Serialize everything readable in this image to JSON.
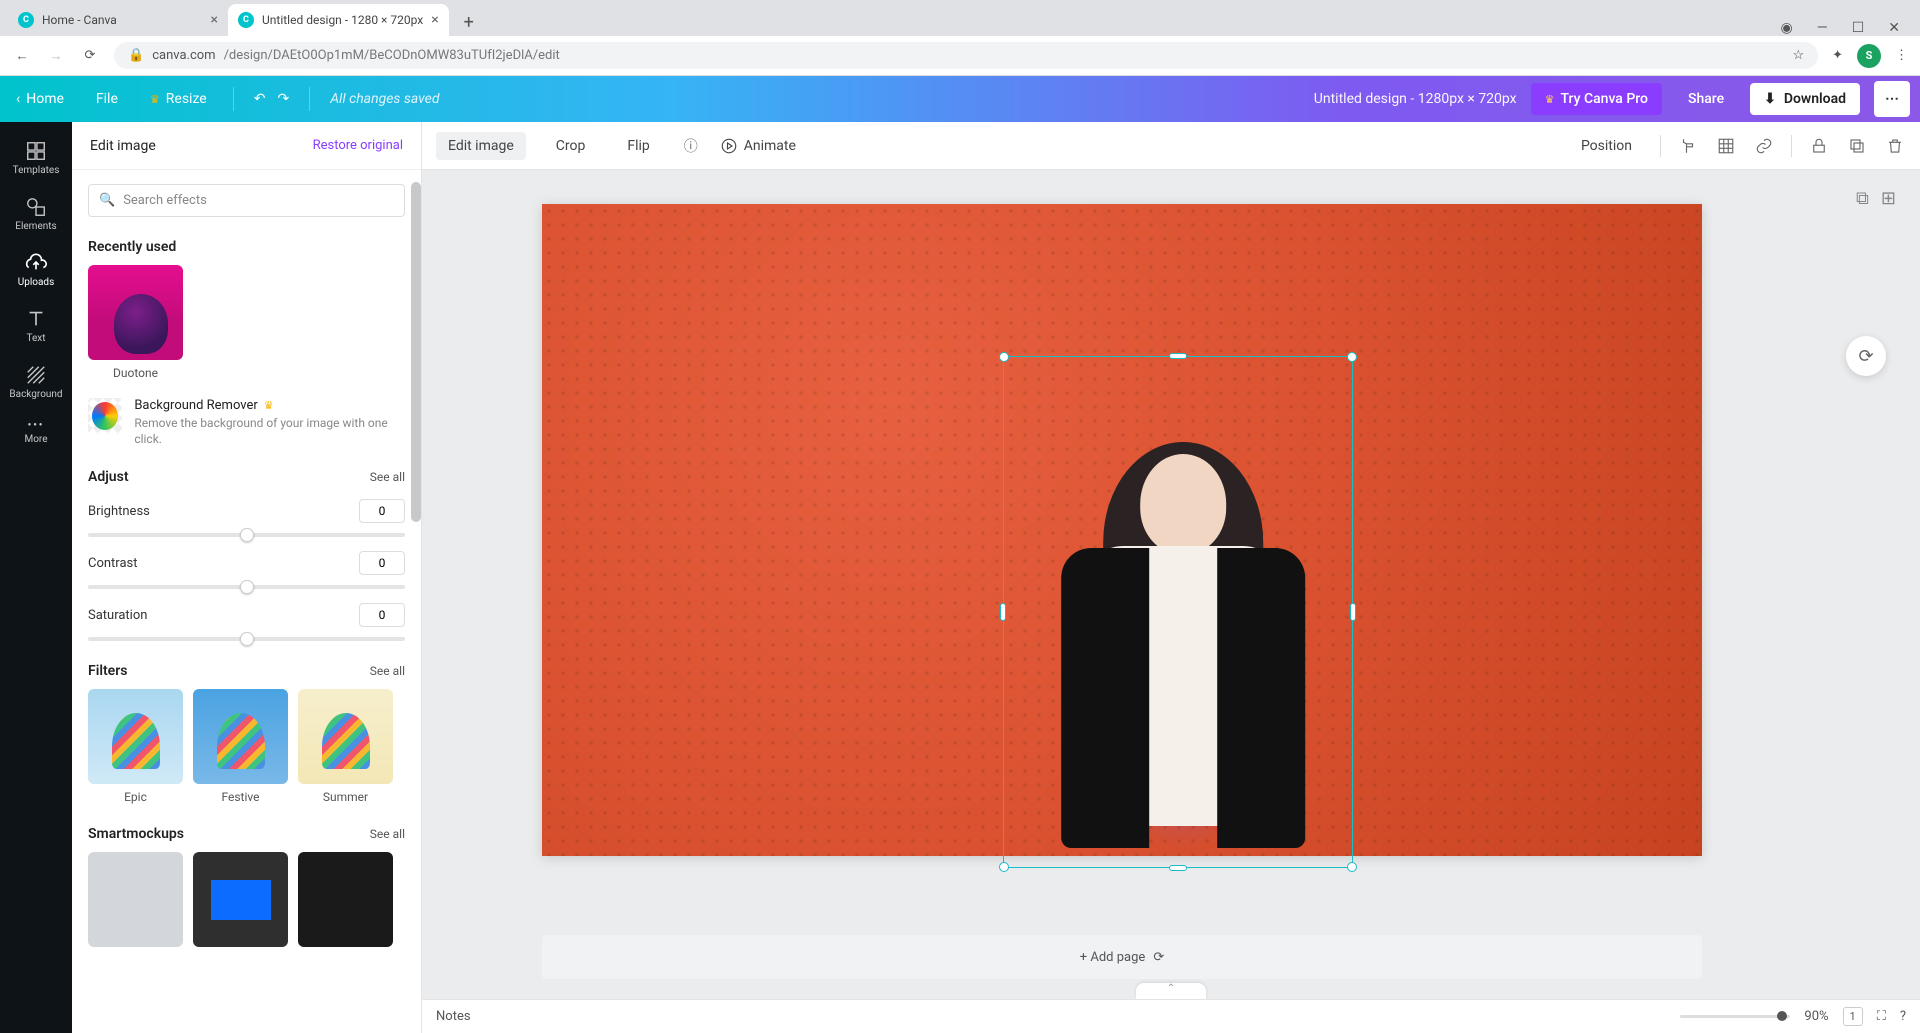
{
  "browser": {
    "tabs": [
      {
        "title": "Home - Canva",
        "active": false
      },
      {
        "title": "Untitled design - 1280 × 720px",
        "active": true
      }
    ],
    "url_host": "canva.com",
    "url_path": "/design/DAEtO0Op1mM/BeCODnOMW83uTUfI2jeDlA/edit",
    "avatar_initial": "S"
  },
  "header": {
    "home": "Home",
    "file": "File",
    "resize": "Resize",
    "status": "All changes saved",
    "doc_title": "Untitled design - 1280px × 720px",
    "try_pro": "Try Canva Pro",
    "share": "Share",
    "download": "Download"
  },
  "rail": {
    "items": [
      {
        "label": "Templates"
      },
      {
        "label": "Elements"
      },
      {
        "label": "Uploads"
      },
      {
        "label": "Text"
      },
      {
        "label": "Background"
      },
      {
        "label": "More"
      }
    ],
    "active_index": 2
  },
  "sidepanel": {
    "title": "Edit image",
    "restore": "Restore original",
    "search_placeholder": "Search effects",
    "recently_used": {
      "heading": "Recently used",
      "items": [
        {
          "label": "Duotone"
        }
      ]
    },
    "bg_remover": {
      "title": "Background Remover",
      "desc": "Remove the background of your image with one click."
    },
    "adjust": {
      "heading": "Adjust",
      "see_all": "See all",
      "controls": [
        {
          "label": "Brightness",
          "value": "0"
        },
        {
          "label": "Contrast",
          "value": "0"
        },
        {
          "label": "Saturation",
          "value": "0"
        }
      ]
    },
    "filters": {
      "heading": "Filters",
      "see_all": "See all",
      "items": [
        {
          "label": "Epic"
        },
        {
          "label": "Festive"
        },
        {
          "label": "Summer"
        }
      ]
    },
    "smartmockups": {
      "heading": "Smartmockups",
      "see_all": "See all"
    }
  },
  "context_toolbar": {
    "edit_image": "Edit image",
    "crop": "Crop",
    "flip": "Flip",
    "animate": "Animate",
    "position": "Position"
  },
  "stage": {
    "add_page": "+ Add page"
  },
  "bottombar": {
    "notes": "Notes",
    "zoom": "90%",
    "page_count": "1"
  }
}
